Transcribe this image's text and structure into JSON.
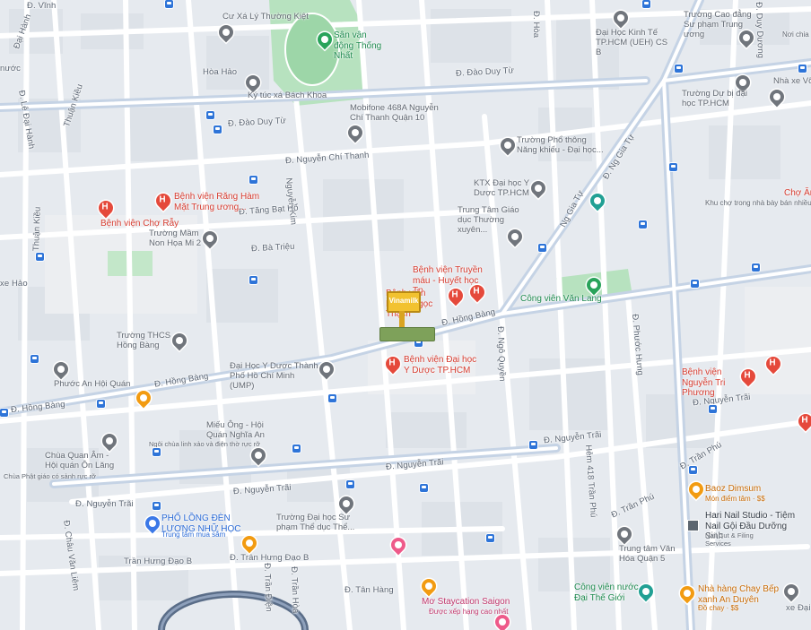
{
  "map": {
    "colors": {
      "background": "#e6eaef",
      "block": "#dfe3e8",
      "road": "#ffffff",
      "major_road": "#c9d6e6",
      "park": "#b9e4c0",
      "special": "#f3ecd7"
    },
    "streets": {
      "vinh": "Đ. Vĩnh",
      "dai_hanh": "Đại Hành",
      "hoa_hao_top": "Hòa Hảo",
      "dao_duy_tu_1": "Đ. Đào Duy Từ",
      "dao_duy_tu_2": "Đ. Đào Duy Từ",
      "nuoc": "nước",
      "le_dai_hanh": "Đ. Lê Đại Hành",
      "thuan_kieu_1": "Thuận Kiều",
      "thuan_kieu_2": "Thuận Kiều",
      "nguyen_chi_thanh": "Đ. Nguyễn Chí Thanh",
      "nguyen_kim": "Nguyễn Kim",
      "tang_bat_ho": "Đ. Tăng Bạt Hổ",
      "ba_trieu": "Đ. Bà Triệu",
      "ho_hao": "xe Hảo",
      "do_hoa": "Đ. Hòa",
      "ng_gia_tu_1": "Đ. Ng Gia Tự",
      "ng_gia_tu_2": "Ng Gia Tự",
      "hong_bang_1": "Đ. Hồng Bàng",
      "hong_bang_2": "Đ. Hồng Bàng",
      "hong_bang_3": "Đ. Hồng Bàng",
      "ngo_quyen": "Đ. Ngô Quyền",
      "phuoc_hung": "Đ. Phước Hưng",
      "nguyen_trai_1": "Đ. Nguyễn Trãi",
      "nguyen_trai_2": "Đ. Nguyễn Trãi",
      "nguyen_trai_3": "Đ. Nguyễn Trãi",
      "nguyen_trai_4": "Đ. Nguyễn Trãi",
      "nguyen_trai_5": "Đ. Nguyễn Trãi",
      "hem_418": "Hẻm 418 Trần Phú",
      "tran_phu_1": "Đ. Trần Phú",
      "tran_phu_2": "Đ. Trần Phú",
      "tran_hung_dao_b": "Trần Hưng Đạo B",
      "tran_hung_dao_b2": "Đ. Trần Hưng Đạo B",
      "tran_dien": "Đ. Trần Điện",
      "tran_hoa": "Đ. Trần Hòa",
      "tan_hang": "Đ. Tân Hàng",
      "chau_van_liem": "Đ. Châu Văn Liêm",
      "duy_duong": "Đ. Duy Dương",
      "xe_dai": "xe Đại"
    },
    "pois": {
      "cu_xa": "Cư Xá Lý Thường Kiệt",
      "san_van_dong": "Sân vận động Thống Nhất",
      "truong_cao_dang": "Trường Cao đẳng Sư phạm Trung ương",
      "noi_chia": "Nơi chia",
      "dh_kinh_te": "Đại Học Kinh Tế TP.HCM (UEH) CS B",
      "ky_tuc_xa": "Ký túc xá Bách Khoa",
      "nha_xe": "Nhà xe Võ",
      "mobifone": "Mobifone 468A Nguyễn Chí Thanh Quận 10",
      "truong_du_bi": "Trường Dự bị đại học TP.HCM",
      "pho_thong_nang_khieu": "Trường Phổ thông Năng khiếu - Đại học...",
      "ktx_dh_y": "KTX Đại học Y Dược TP.HCM",
      "bv_rang_ham_mat": "Bệnh viện Răng Hàm Mặt Trung ương...",
      "bv_cho_ray": "Bệnh viện Chợ Rẫy",
      "mam_non": "Trường Mầm Non Họa Mi 2",
      "trung_tam_giao_duc": "Trung Tâm Giáo dục Thường xuyên...",
      "cho_an": "Chợ Ăn",
      "khu_cho": "Khu chợ trong nhà bày bán nhiều",
      "bv_truyen_mau": "Bệnh viện Truyền máu - Huyết học Tp",
      "bv_pham_ngoc_thach": "Bệnh viện Phạm Ngọc Thạch",
      "cong_vien_van_lang": "Công viên Văn Lang",
      "thcs_hong_bang": "Trường THCS Hồng Bàng",
      "bv_dh_y_duoc": "Bệnh viện Đại học Y Dược TP.HCM",
      "dh_y_duoc": "Đại Học Y Dược Thành Phố Hồ Chí Minh (UMP)",
      "bv_nguyen_tri_phuong": "Bệnh viện Nguyễn Tri Phương",
      "phuoc_an_hoi_quan": "Phước An Hội Quán",
      "mieu_ong": "Miếu Ông - Hội Quán Nghĩa An",
      "mieu_ong_sub": "Ngôi chùa linh xảo và điện thờ rực rỡ",
      "chua_quan_am": "Chùa Quan Âm - Hội quán Ôn Lăng",
      "chua_quan_am_sub": "Chùa Phật giáo có sảnh rực rỡ",
      "baoz_dimsum": "Baoz Dimsum",
      "baoz_sub": "Món điểm tâm · $$",
      "hari_nail": "Hari Nail Studio - Tiệm Nail Gội Đầu Dưỡng Sinh",
      "hari_sub": "Nail Cut & Filing Services",
      "pho_long_den": "PHỐ LỒNG ĐÈN LƯƠNG NHỮ HỌC",
      "pho_long_den_sub": "Trung tâm mua sắm",
      "truong_dh_su_pham": "Trường Đại học Sư phạm Thể dục Thể...",
      "trung_tam_van_hoa": "Trung tâm Văn Hóa Quận 5",
      "cong_vien_nuoc": "Công viên nước Đại Thế Giới",
      "nha_hang_chay": "Nhà hàng Chay Bếp xanh An Duyên",
      "nha_hang_sub": "Đồ chay · $$",
      "mo_staycation": "Mơ Staycation Saigon",
      "mo_sub": "Được xếp hạng cao nhất",
      "billboard": "Vinamilk"
    }
  }
}
